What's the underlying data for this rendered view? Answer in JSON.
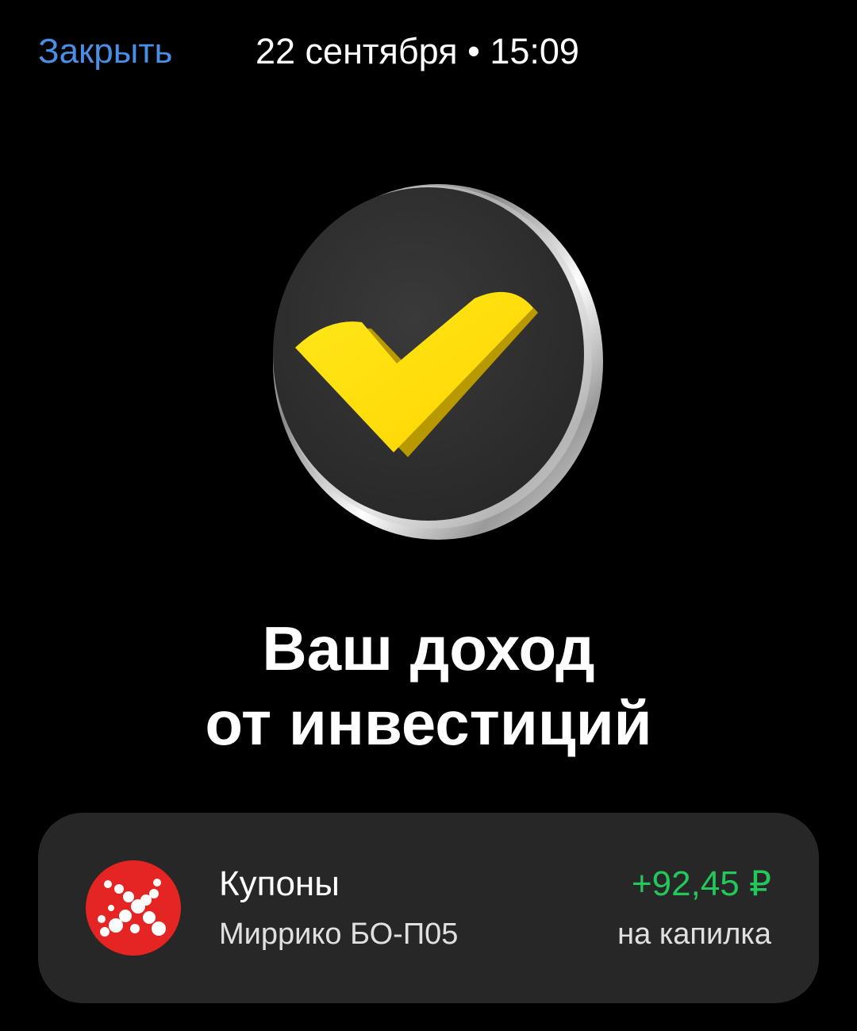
{
  "header": {
    "close_label": "Закрыть",
    "datetime": "22 сентября • 15:09"
  },
  "hero": {
    "icon": "yellow-checkmark-coin-icon",
    "check_color": "#ffdd00"
  },
  "headline": {
    "line1": "Ваш доход",
    "line2": "от инвестиций"
  },
  "income_card": {
    "title": "Купоны",
    "subtitle": "Миррико БО-П05",
    "amount": "+92,45 ₽",
    "destination": "на капилка",
    "logo_icon": "mirriko-logo-icon",
    "logo_color": "#e52424",
    "amount_color": "#24c85a"
  },
  "colors": {
    "background": "#000000",
    "link": "#4a8fe6",
    "card": "#272727"
  }
}
